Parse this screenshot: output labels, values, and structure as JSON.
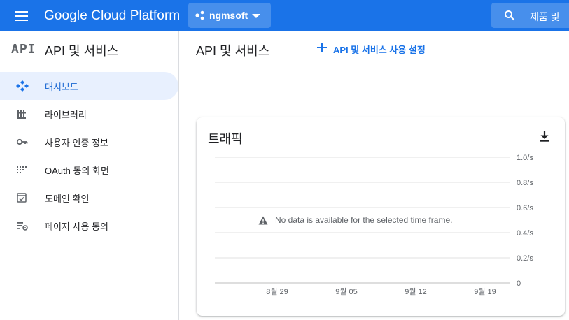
{
  "topbar": {
    "brand": "Google Cloud Platform",
    "project_name": "ngmsoft",
    "search_placeholder": "제품 및"
  },
  "sidebar": {
    "logo": "API",
    "title": "API 및 서비스",
    "items": [
      {
        "label": "대시보드",
        "icon": "dashboard-icon",
        "active": true
      },
      {
        "label": "라이브러리",
        "icon": "library-icon",
        "active": false
      },
      {
        "label": "사용자 인증 정보",
        "icon": "key-icon",
        "active": false
      },
      {
        "label": "OAuth 동의 화면",
        "icon": "oauth-consent-icon",
        "active": false
      },
      {
        "label": "도메인 확인",
        "icon": "domain-verification-icon",
        "active": false
      },
      {
        "label": "페이지 사용 동의",
        "icon": "page-usage-agreement-icon",
        "active": false
      }
    ]
  },
  "main": {
    "title": "API 및 서비스",
    "enable_button": "API 및 서비스 사용 설정"
  },
  "traffic_card": {
    "title": "트래픽",
    "no_data_message": "No data is available for the selected time frame."
  },
  "colors": {
    "brand_blue": "#1a73e8",
    "active_nav_bg": "#e8f0fe",
    "active_nav_text": "#1967d2",
    "gridline": "#e0e0e0",
    "axis_text": "#5f6368"
  },
  "chart_data": {
    "type": "line",
    "title": "트래픽",
    "x_ticks": [
      "8월 29",
      "9월 05",
      "9월 12",
      "9월 19"
    ],
    "y_ticks": [
      "1.0/s",
      "0.8/s",
      "0.6/s",
      "0.4/s",
      "0.2/s",
      "0"
    ],
    "y_values": [
      1.0,
      0.8,
      0.6,
      0.4,
      0.2,
      0
    ],
    "ylim": [
      0,
      1.0
    ],
    "series": [],
    "grid": true,
    "legend": "none"
  }
}
